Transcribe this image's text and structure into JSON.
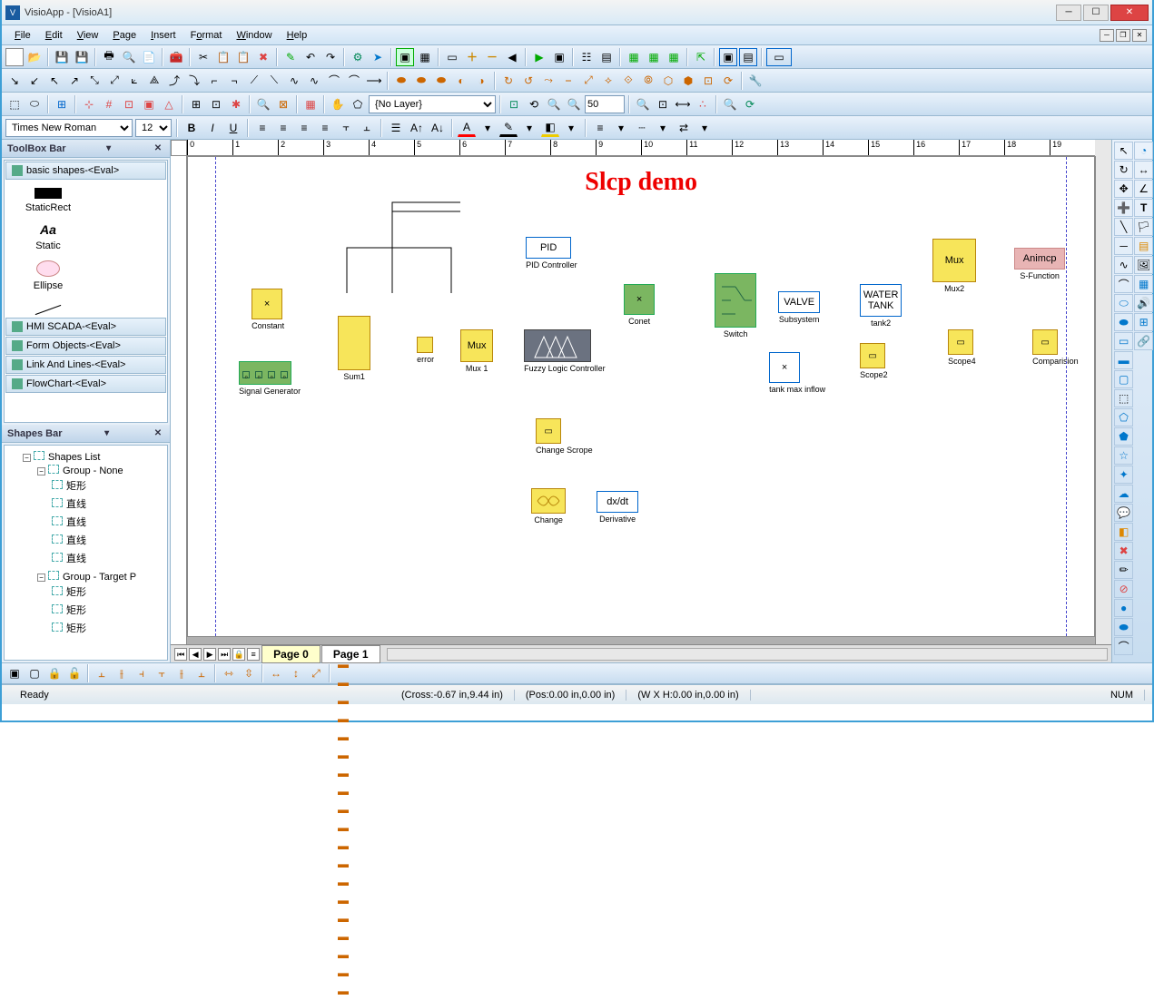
{
  "title": "VisioApp - [VisioA1]",
  "menu": [
    "File",
    "Edit",
    "View",
    "Page",
    "Insert",
    "Format",
    "Window",
    "Help"
  ],
  "font": {
    "name": "Times New Roman",
    "size": "12"
  },
  "layer_combo": "{No Layer}",
  "zoom": "50",
  "toolbox": {
    "title": "ToolBox Bar",
    "active_cat": "basic shapes-<Eval>",
    "shapes": [
      {
        "name": "StaticRect"
      },
      {
        "name": "Static",
        "glyph": "Aa"
      },
      {
        "name": "Ellipse"
      },
      {
        "name": "Line"
      }
    ],
    "cats": [
      "HMI SCADA-<Eval>",
      "Form Objects-<Eval>",
      "Link And Lines-<Eval>",
      "FlowChart-<Eval>"
    ]
  },
  "shapes_bar": {
    "title": "Shapes Bar",
    "root": "Shapes List",
    "groups": [
      {
        "name": "Group - None",
        "items": [
          "矩形",
          "直线",
          "直线",
          "直线",
          "直线"
        ]
      },
      {
        "name": "Group - Target P",
        "items": [
          "矩形",
          "矩形",
          "矩形"
        ]
      }
    ]
  },
  "diagram": {
    "title": "Slcp demo",
    "blocks": {
      "constant": {
        "label": "Constant",
        "text": "×"
      },
      "siggen": {
        "label": "Signal Generator"
      },
      "sum1": {
        "label": "Sum1"
      },
      "error": {
        "label": "error"
      },
      "mux1": {
        "label": "Mux 1",
        "text": "Mux"
      },
      "fuzzy": {
        "label": "Fuzzy Logic Controller"
      },
      "pid": {
        "label": "PID Controller",
        "text": "PID"
      },
      "change_scope": {
        "label": "Change Scrope"
      },
      "change": {
        "label": "Change"
      },
      "derivative": {
        "label": "Derivative",
        "text": "dx/dt"
      },
      "conet": {
        "label": "Conet",
        "text": "×"
      },
      "switch": {
        "label": "Switch"
      },
      "valve": {
        "label": "Subsystem",
        "text": "VALVE"
      },
      "tank": {
        "label": "tank2",
        "text": "WATER TANK"
      },
      "tankmax": {
        "label": "tank max inflow",
        "text": "×"
      },
      "scope2": {
        "label": "Scope2"
      },
      "mux2": {
        "label": "Mux2",
        "text": "Mux"
      },
      "scope4": {
        "label": "Scope4"
      },
      "animcp": {
        "label": "S-Function",
        "text": "Animcp"
      },
      "comparison": {
        "label": "Comparision"
      }
    }
  },
  "tabs": {
    "current": "Page   0",
    "other": "Page  1"
  },
  "status": {
    "ready": "Ready",
    "cross": "(Cross:-0.67 in,9.44 in)",
    "pos": "(Pos:0.00 in,0.00 in)",
    "wh": "(W X H:0.00 in,0.00 in)",
    "num": "NUM"
  },
  "ruler_ticks": [
    "0",
    "1",
    "2",
    "3",
    "4",
    "5",
    "6",
    "7",
    "8",
    "9",
    "10",
    "11",
    "12",
    "13",
    "14",
    "15",
    "16",
    "17",
    "18",
    "19"
  ]
}
